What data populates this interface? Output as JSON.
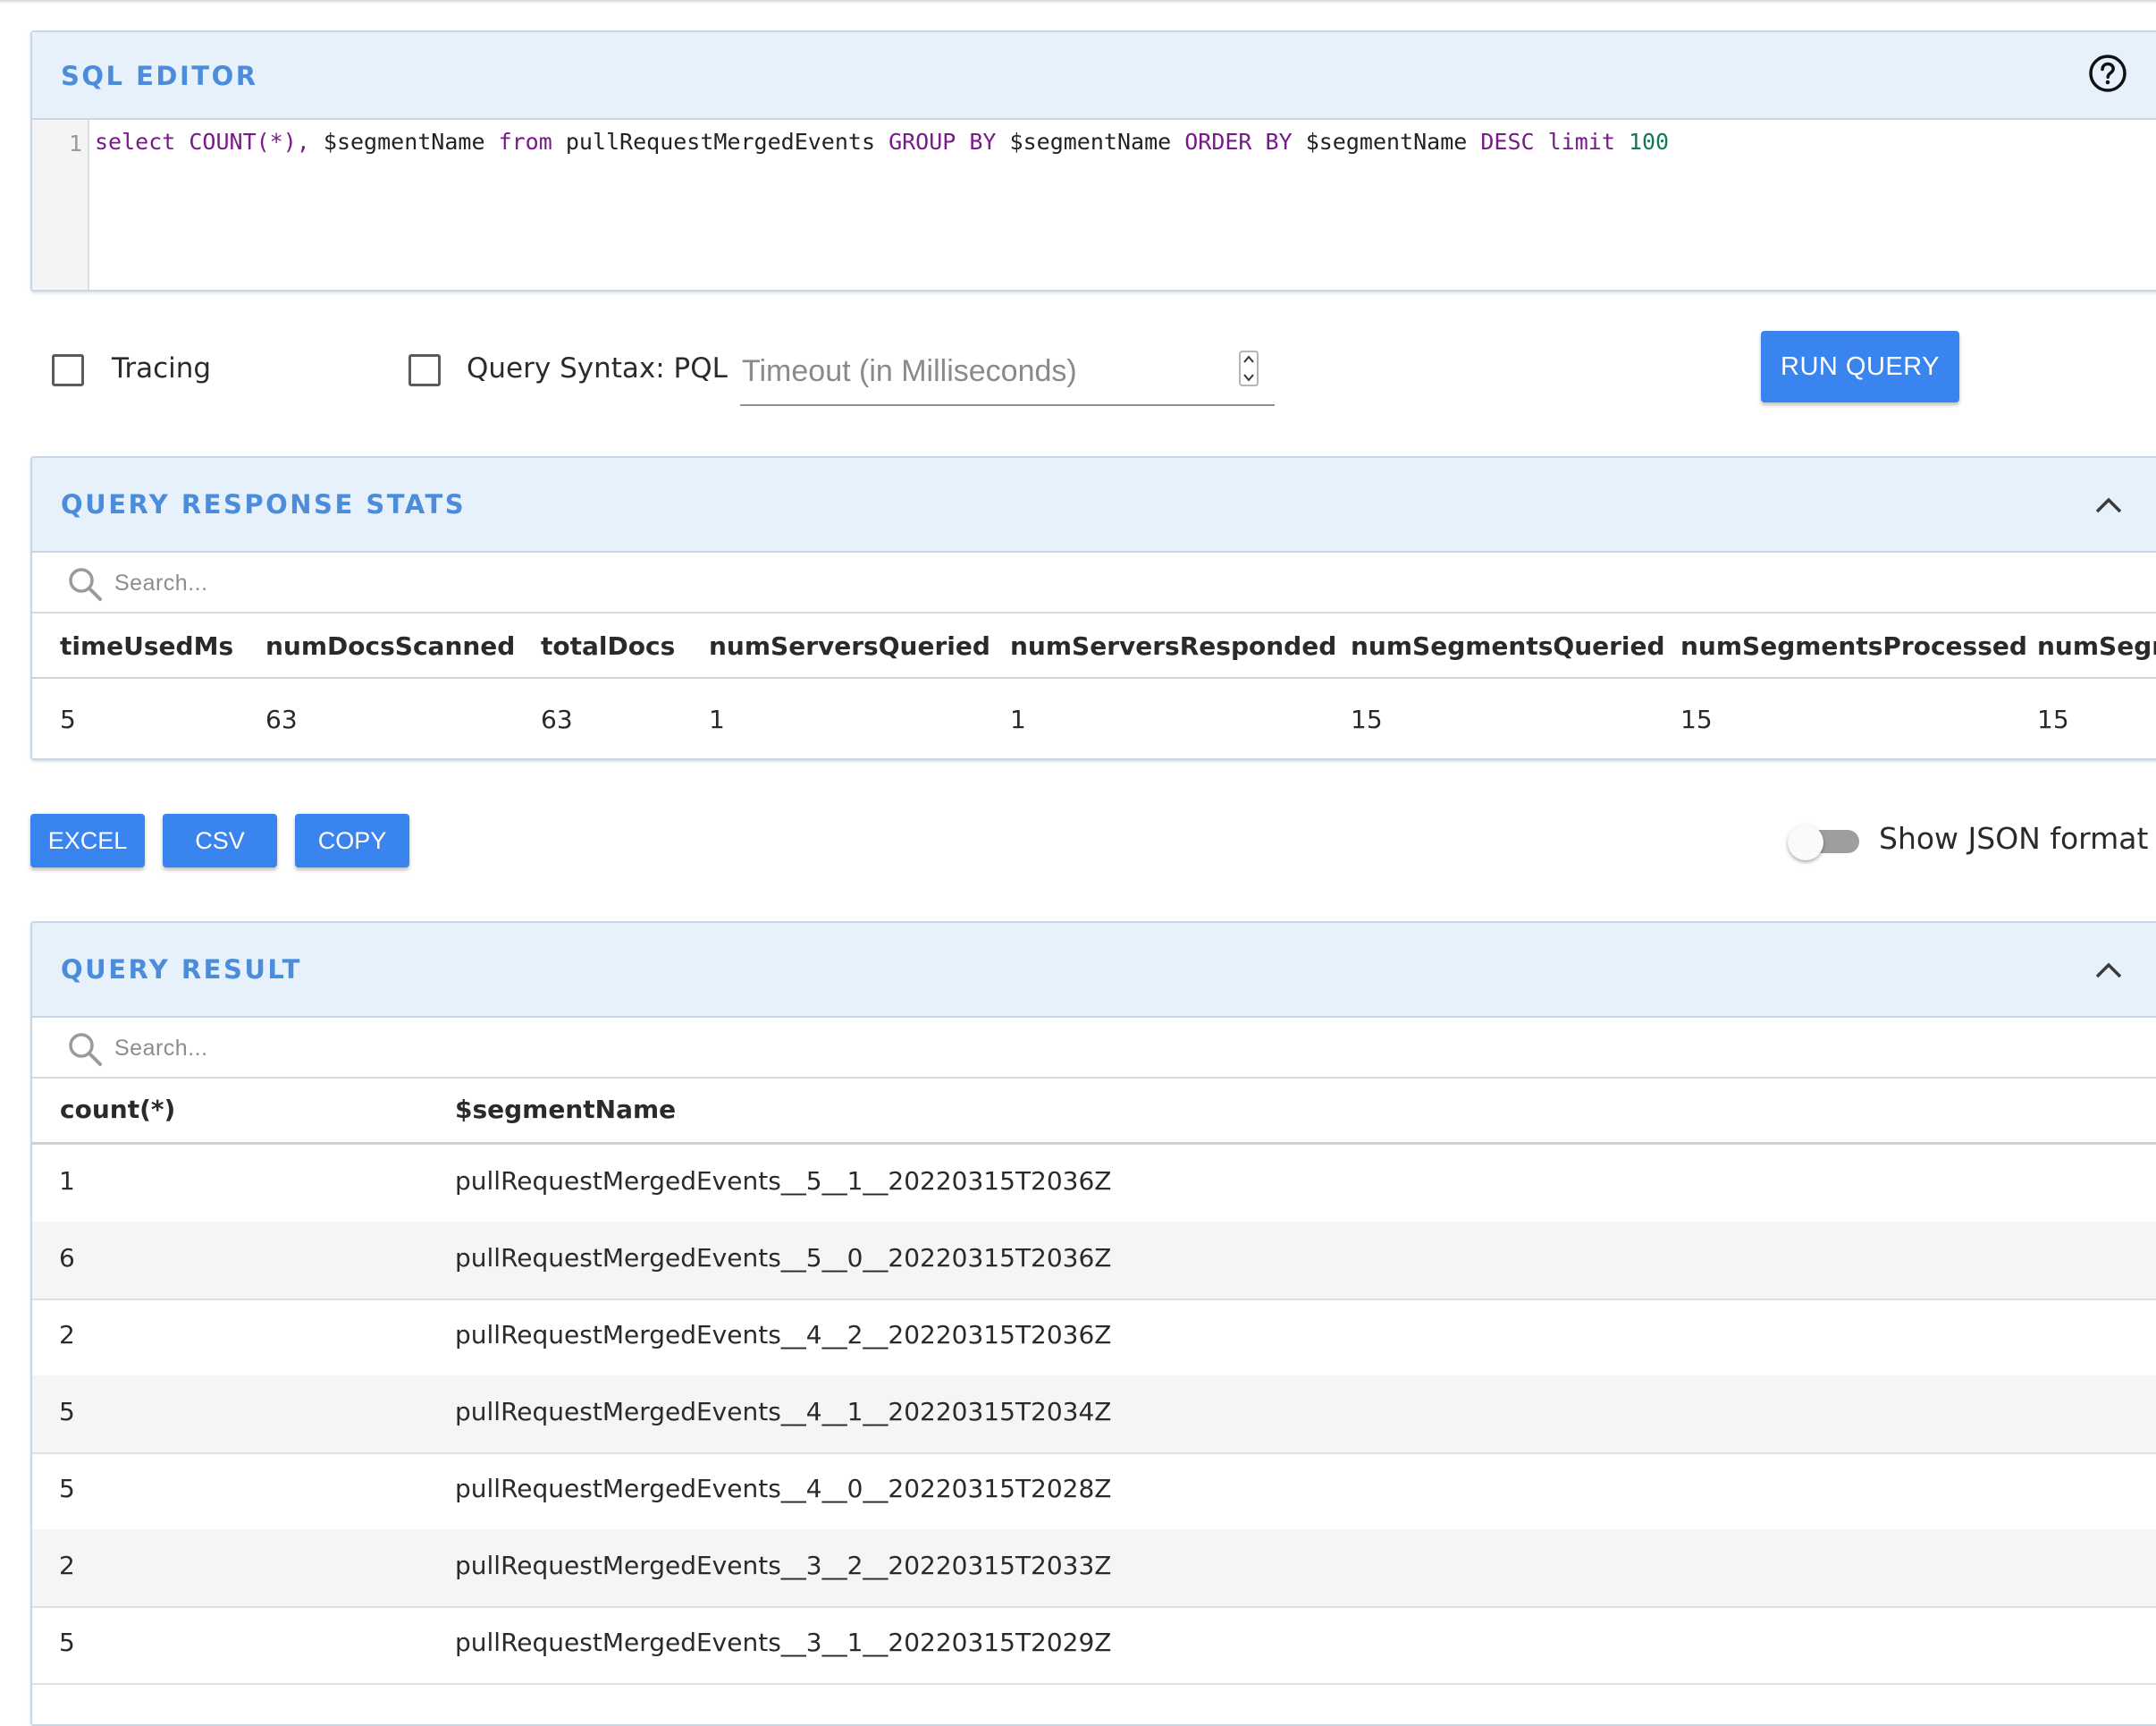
{
  "sql_editor": {
    "title": "SQL EDITOR",
    "line_number": "1",
    "query": {
      "select": "select",
      "count": "COUNT(*), ",
      "seg1": "$segmentName ",
      "from": "from",
      "table": " pullRequestMergedEvents ",
      "group_by": "GROUP BY",
      "seg2": " $segmentName ",
      "order_by": "ORDER BY",
      "seg3": " $segmentName ",
      "desc": "DESC",
      "limit": " limit",
      "limit_value": " 100"
    }
  },
  "options": {
    "tracing_label": "Tracing",
    "tracing_checked": false,
    "syntax_label": "Query Syntax: PQL",
    "syntax_checked": false,
    "timeout_placeholder": "Timeout (in Milliseconds)",
    "timeout_value": "",
    "run_button": "RUN QUERY"
  },
  "stats": {
    "title": "QUERY RESPONSE STATS",
    "search_placeholder": "Search...",
    "columns": [
      "timeUsedMs",
      "numDocsScanned",
      "totalDocs",
      "numServersQueried",
      "numServersResponded",
      "numSegmentsQueried",
      "numSegmentsProcessed",
      "numSegm"
    ],
    "values": [
      "5",
      "63",
      "63",
      "1",
      "1",
      "15",
      "15",
      "15"
    ]
  },
  "actions": {
    "excel": "EXCEL",
    "csv": "CSV",
    "copy": "COPY",
    "json_toggle_label": "Show JSON format",
    "json_toggle_on": false
  },
  "result": {
    "title": "QUERY RESULT",
    "search_placeholder": "Search...",
    "columns": [
      "count(*)",
      "$segmentName"
    ],
    "rows": [
      [
        "1",
        "pullRequestMergedEvents__5__1__20220315T2036Z"
      ],
      [
        "6",
        "pullRequestMergedEvents__5__0__20220315T2036Z"
      ],
      [
        "2",
        "pullRequestMergedEvents__4__2__20220315T2036Z"
      ],
      [
        "5",
        "pullRequestMergedEvents__4__1__20220315T2034Z"
      ],
      [
        "5",
        "pullRequestMergedEvents__4__0__20220315T2028Z"
      ],
      [
        "2",
        "pullRequestMergedEvents__3__2__20220315T2033Z"
      ],
      [
        "5",
        "pullRequestMergedEvents__3__1__20220315T2029Z"
      ]
    ]
  },
  "colors": {
    "accent": "#3a84f0",
    "panel_header_bg": "#e7f1fc",
    "panel_title": "#4b8ddb",
    "sql_keyword": "#7a1a8a",
    "sql_number": "#117a52"
  },
  "icons": {
    "help": "help-circle-icon",
    "collapse": "chevron-up-icon",
    "search": "search-icon",
    "spinner": "spinner-arrows-icon"
  }
}
